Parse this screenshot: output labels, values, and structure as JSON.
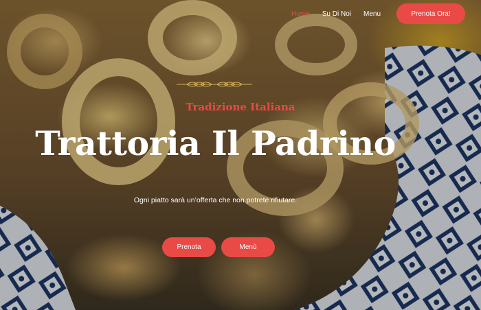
{
  "nav": {
    "items": [
      {
        "label": "Home",
        "active": true
      },
      {
        "label": "Su Di Noi",
        "active": false
      },
      {
        "label": "Menu",
        "active": false
      }
    ],
    "cta_label": "Prenota Ora!"
  },
  "hero": {
    "tagline": "Tradizione Italiana",
    "title": "Trattoria Il Padrino",
    "subtitle": "Ogni piatto sarà un’offerta che non potrete rifiutare.",
    "buttons": [
      {
        "label": "Prenota"
      },
      {
        "label": "Menù"
      }
    ]
  },
  "colors": {
    "accent": "#e94a45",
    "text": "#ffffff"
  },
  "icons": {
    "ornament": "wheat-ornament-icon"
  }
}
